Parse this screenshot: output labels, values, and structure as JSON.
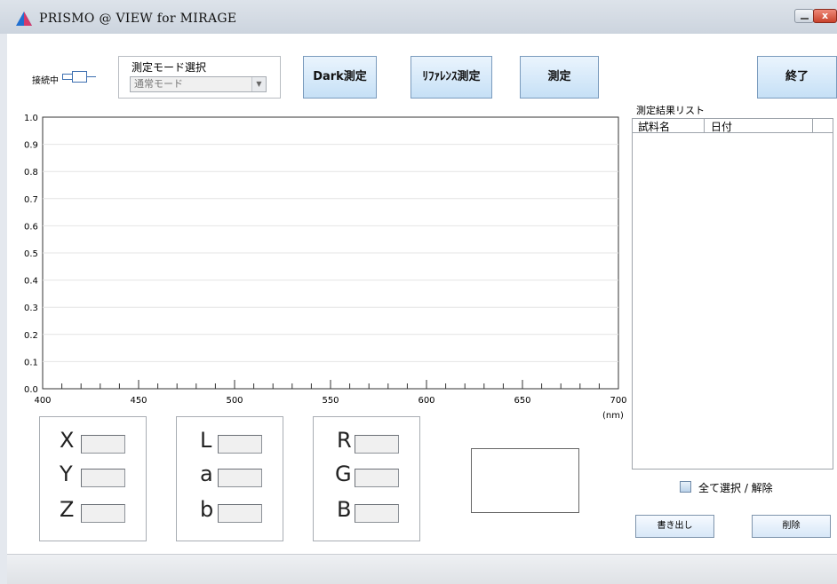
{
  "window": {
    "title": "PRISMO @ VIEW for MIRAGE",
    "close_glyph": "x"
  },
  "connection": {
    "label": "接続中",
    "icon": "connector-icon"
  },
  "mode": {
    "label": "測定モード選択",
    "selected": "通常モード"
  },
  "toolbar": {
    "dark_label": "Dark測定",
    "reference_label": "ﾘﾌｧﾚﾝｽ測定",
    "measure_label": "測定",
    "exit_label": "終了"
  },
  "chart_data": {
    "type": "line",
    "xlabel": "(nm)",
    "ylabel": "",
    "xlim": [
      400,
      700
    ],
    "ylim": [
      0.0,
      1.0
    ],
    "x_ticks": [
      "400",
      "450",
      "500",
      "550",
      "600",
      "650",
      "700"
    ],
    "y_ticks": [
      "0.0",
      "0.1",
      "0.2",
      "0.3",
      "0.4",
      "0.5",
      "0.6",
      "0.7",
      "0.8",
      "0.9",
      "1.0"
    ],
    "grid": true,
    "series": []
  },
  "results": {
    "label": "測定結果リスト",
    "columns": [
      "試料名",
      "日付"
    ],
    "rows": [],
    "select_all_label": "全て選択 / 解除",
    "select_all_checked": false,
    "export_label": "書き出し",
    "delete_label": "削除"
  },
  "color_values": {
    "xyz": [
      {
        "name": "X",
        "value": ""
      },
      {
        "name": "Y",
        "value": ""
      },
      {
        "name": "Z",
        "value": ""
      }
    ],
    "lab": [
      {
        "name": "L",
        "value": ""
      },
      {
        "name": "a",
        "value": ""
      },
      {
        "name": "b",
        "value": ""
      }
    ],
    "rgb": [
      {
        "name": "R",
        "value": ""
      },
      {
        "name": "G",
        "value": ""
      },
      {
        "name": "B",
        "value": ""
      }
    ]
  },
  "colors": {
    "title_icon": "#1e6fd0",
    "button_top": "#eaf4fd",
    "button_bottom": "#c6e0f6",
    "gridline": "#e4e4e4"
  }
}
